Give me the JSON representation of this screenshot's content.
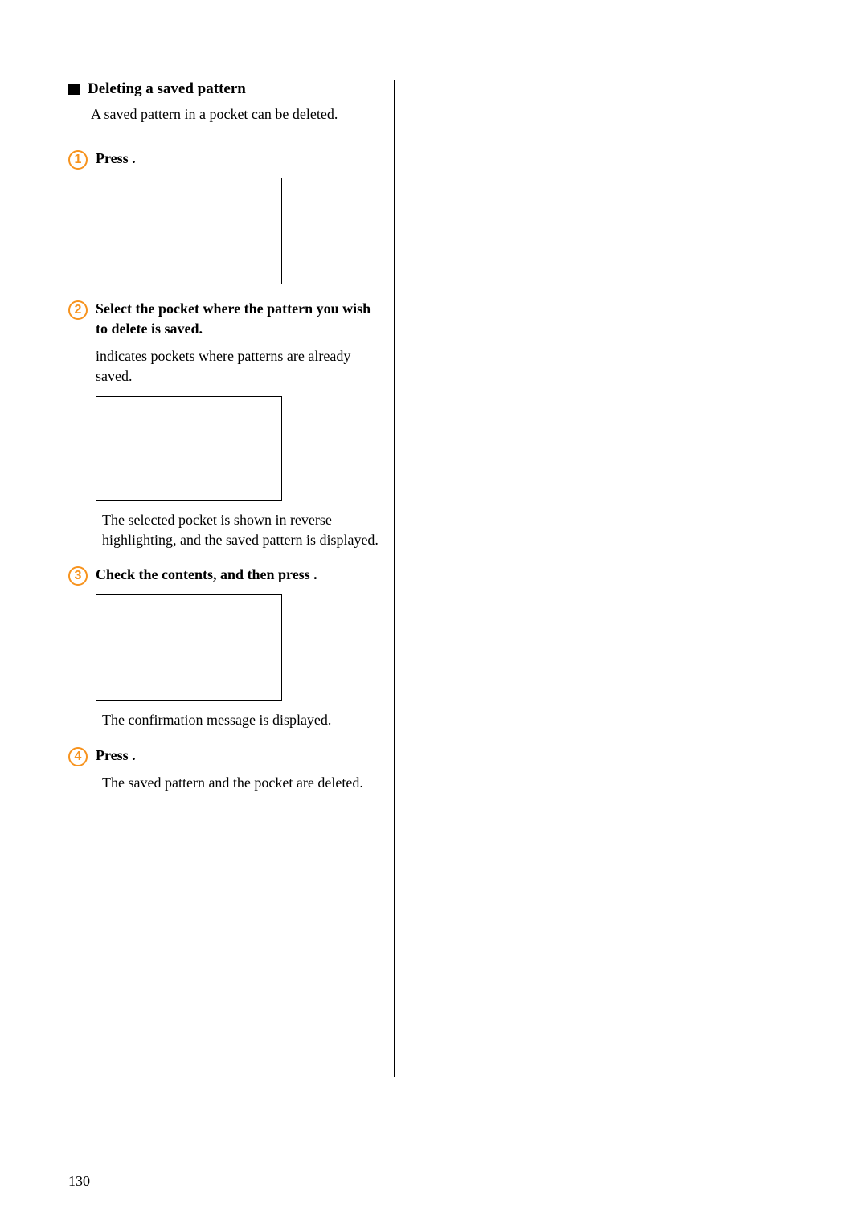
{
  "section": {
    "title": "Deleting a saved pattern",
    "description": "A saved pattern in a pocket can be deleted."
  },
  "steps": [
    {
      "number": "1",
      "title": "Press          ."
    },
    {
      "number": "2",
      "title": "Select the pocket where the pattern you wish to delete is saved.",
      "note": "        indicates pockets where patterns are already saved.",
      "result": "The selected pocket is shown in reverse highlighting, and the saved pattern is displayed."
    },
    {
      "number": "3",
      "title": "Check the contents, and then press           .",
      "result": "The confirmation message is displayed."
    },
    {
      "number": "4",
      "title": "Press              .",
      "result": "The saved pattern and the pocket are deleted."
    }
  ],
  "pageNumber": "130"
}
